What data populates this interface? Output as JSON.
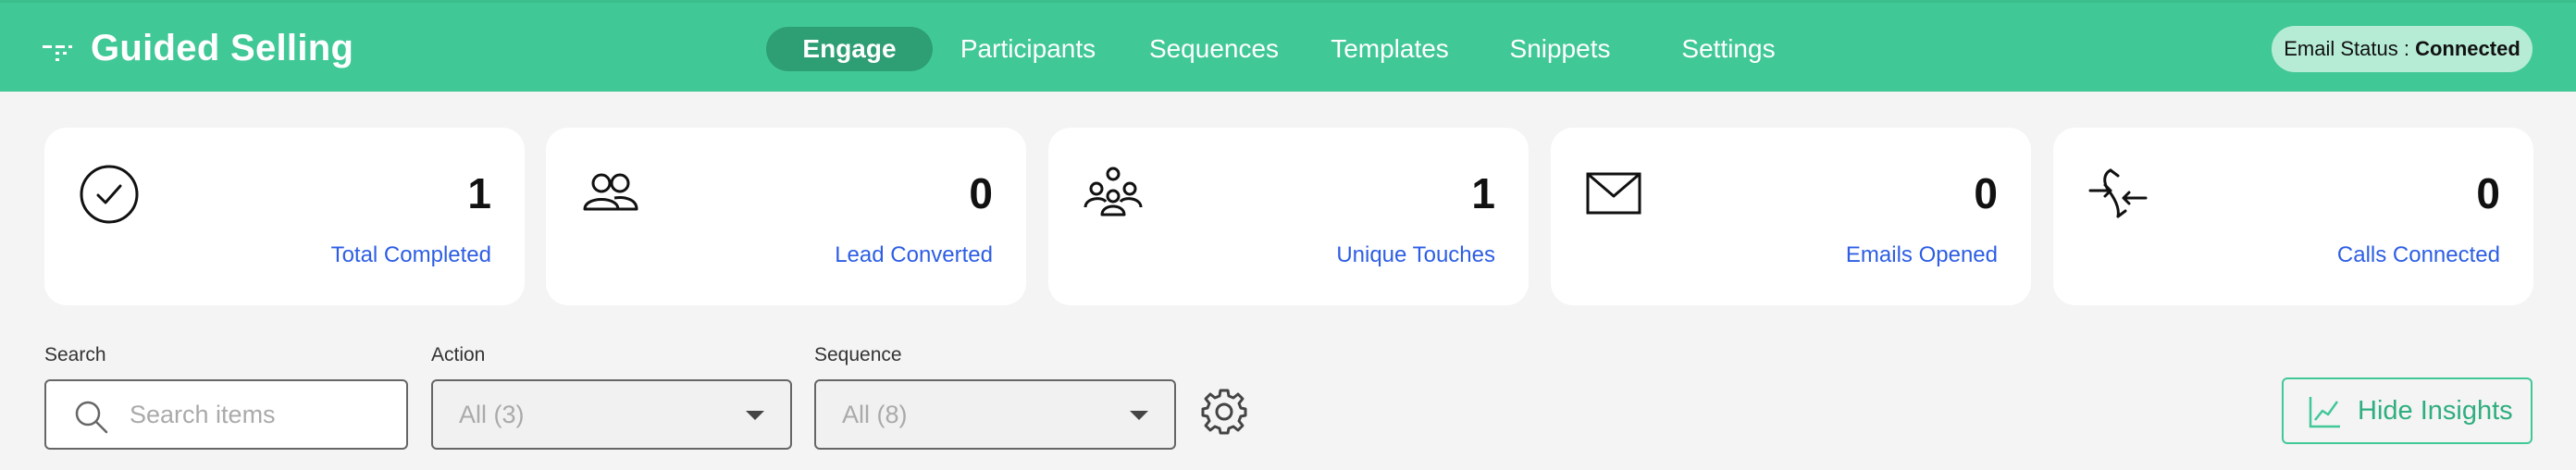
{
  "app": {
    "title": "Guided Selling",
    "logo_icon": "dashed-lines-logo-icon"
  },
  "nav": {
    "items": [
      {
        "label": "Engage",
        "active": true
      },
      {
        "label": "Participants",
        "active": false
      },
      {
        "label": "Sequences",
        "active": false
      },
      {
        "label": "Templates",
        "active": false
      },
      {
        "label": "Snippets",
        "active": false
      },
      {
        "label": "Settings",
        "active": false
      }
    ]
  },
  "email_status": {
    "label": "Email Status : ",
    "value": "Connected"
  },
  "stats": [
    {
      "icon": "check-circle-icon",
      "value": "1",
      "label": "Total Completed"
    },
    {
      "icon": "two-people-icon",
      "value": "0",
      "label": "Lead Converted"
    },
    {
      "icon": "group-people-icon",
      "value": "1",
      "label": "Unique Touches"
    },
    {
      "icon": "envelope-icon",
      "value": "0",
      "label": "Emails Opened"
    },
    {
      "icon": "phone-arrows-icon",
      "value": "0",
      "label": "Calls Connected"
    }
  ],
  "filters": {
    "search": {
      "label": "Search",
      "placeholder": "Search items"
    },
    "action": {
      "label": "Action",
      "value": "All (3)"
    },
    "sequence": {
      "label": "Sequence",
      "value": "All (8)"
    },
    "settings_icon": "gear-icon"
  },
  "insights_button": {
    "label": "Hide Insights",
    "icon": "line-chart-icon"
  },
  "colors": {
    "brand": "#41c897",
    "nav_active": "#2e9e74",
    "link": "#2d5ee4",
    "status_pill": "#b6ecd6"
  }
}
